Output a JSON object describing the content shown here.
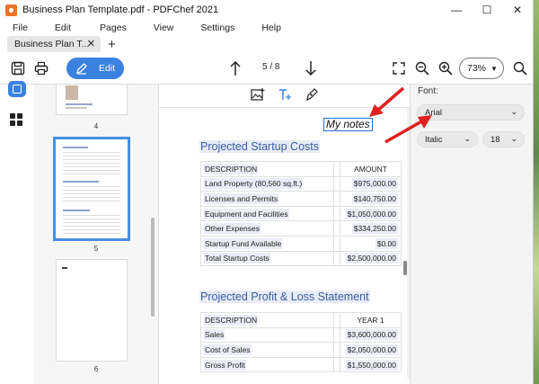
{
  "window": {
    "title": "Business Plan Template.pdf - PDFChef 2021",
    "controls": [
      "—",
      "☐",
      "✕"
    ]
  },
  "menu": [
    "File",
    "Edit",
    "Pages",
    "View",
    "Settings",
    "Help"
  ],
  "tab": {
    "label": "Business Plan T...",
    "close": "✕",
    "add": "+"
  },
  "toolbar": {
    "edit_label": "Edit",
    "page_indicator": "5 / 8",
    "zoom_value": "73%"
  },
  "thumbnails": [
    {
      "number": "4",
      "selected": false
    },
    {
      "number": "5",
      "selected": true
    },
    {
      "number": "6",
      "selected": false
    }
  ],
  "document": {
    "annotation_text": "My notes",
    "section1": {
      "title": "Projected Startup Costs",
      "headers": [
        "DESCRIPTION",
        "AMOUNT"
      ],
      "rows": [
        [
          "Land Property (80,560 sq.ft.)",
          "$975,000.00"
        ],
        [
          "Licenses and Permits",
          "$140,750.00"
        ],
        [
          "Equipment and Facilities",
          "$1,050,000.00"
        ],
        [
          "Other Expenses",
          "$334,250.00"
        ],
        [
          "Startup Fund Available",
          "$0.00"
        ],
        [
          "Total Startup Costs",
          "$2,500,000.00"
        ]
      ]
    },
    "section2": {
      "title": "Projected Profit & Loss Statement",
      "headers": [
        "DESCRIPTION",
        "YEAR 1"
      ],
      "rows": [
        [
          "Sales",
          "$3,600,000.00"
        ],
        [
          "Cost of Sales",
          "$2,050,000.00"
        ],
        [
          "Gross Profit",
          "$1,550,000.00"
        ]
      ]
    }
  },
  "font_panel": {
    "label": "Font:",
    "family": "Arial",
    "style": "Italic",
    "size": "18"
  },
  "colors": {
    "accent": "#3b82e0",
    "heading": "#3a5ea8",
    "arrow": "#e02020"
  }
}
